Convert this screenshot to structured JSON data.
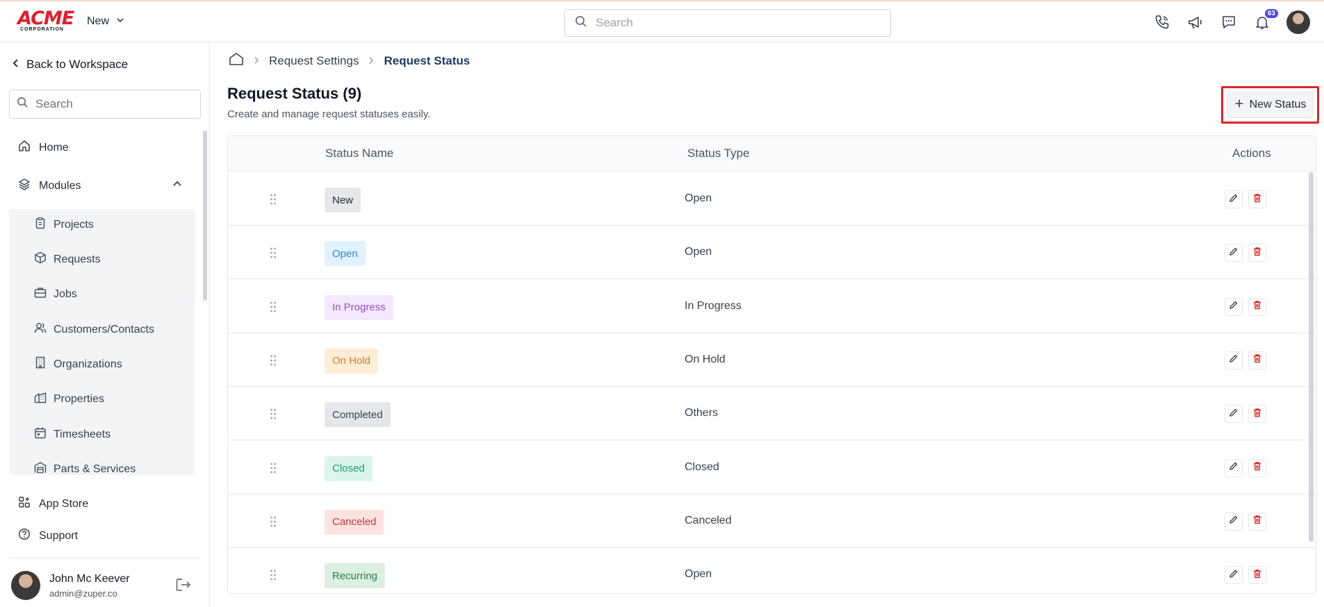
{
  "topbar": {
    "logo_main": "ACME",
    "logo_sub": "CORPORATION",
    "new_label": "New",
    "search_placeholder": "Search",
    "notification_count": "63",
    "icons": [
      "phone-icon",
      "megaphone-icon",
      "chat-icon",
      "bell-icon",
      "avatar"
    ]
  },
  "sidebar": {
    "back_label": "Back to Workspace",
    "search_placeholder": "Search",
    "home_label": "Home",
    "modules_label": "Modules",
    "modules": [
      {
        "label": "Projects",
        "icon": "clipboard-icon"
      },
      {
        "label": "Requests",
        "icon": "box-icon"
      },
      {
        "label": "Jobs",
        "icon": "briefcase-icon"
      },
      {
        "label": "Customers/Contacts",
        "icon": "users-icon"
      },
      {
        "label": "Organizations",
        "icon": "building-icon"
      },
      {
        "label": "Properties",
        "icon": "property-icon"
      },
      {
        "label": "Timesheets",
        "icon": "calendar-icon"
      },
      {
        "label": "Parts & Services",
        "icon": "warehouse-icon"
      }
    ],
    "app_store_label": "App Store",
    "support_label": "Support",
    "user": {
      "name": "John Mc Keever",
      "email": "admin@zuper.co"
    }
  },
  "breadcrumb": {
    "parent": "Request Settings",
    "current": "Request Status"
  },
  "page": {
    "title": "Request Status (9)",
    "subtitle": "Create and manage request statuses easily.",
    "new_button": "New Status"
  },
  "table": {
    "headers": {
      "name": "Status Name",
      "type": "Status Type",
      "actions": "Actions"
    },
    "rows": [
      {
        "name": "New",
        "type": "Open",
        "bg": "#e5e7eb",
        "fg": "#1f2937"
      },
      {
        "name": "Open",
        "type": "Open",
        "bg": "#e0f2fe",
        "fg": "#2b8ad0"
      },
      {
        "name": "In Progress",
        "type": "In Progress",
        "bg": "#f3e8ff",
        "fg": "#9b4fc0"
      },
      {
        "name": "On Hold",
        "type": "On Hold",
        "bg": "#ffedd5",
        "fg": "#e0782a"
      },
      {
        "name": "Completed",
        "type": "Others",
        "bg": "#e5e7eb",
        "fg": "#374151"
      },
      {
        "name": "Closed",
        "type": "Closed",
        "bg": "#dcf5ec",
        "fg": "#1f9d6e"
      },
      {
        "name": "Canceled",
        "type": "Canceled",
        "bg": "#fde2e2",
        "fg": "#c0392b"
      },
      {
        "name": "Recurring",
        "type": "Open",
        "bg": "#dcefe3",
        "fg": "#2f7a4a"
      }
    ]
  },
  "colors": {
    "accent_red": "#dc2626",
    "brand_red": "#e11d2e",
    "badge_purple": "#4f46e5",
    "delete_red": "#dc2626"
  }
}
